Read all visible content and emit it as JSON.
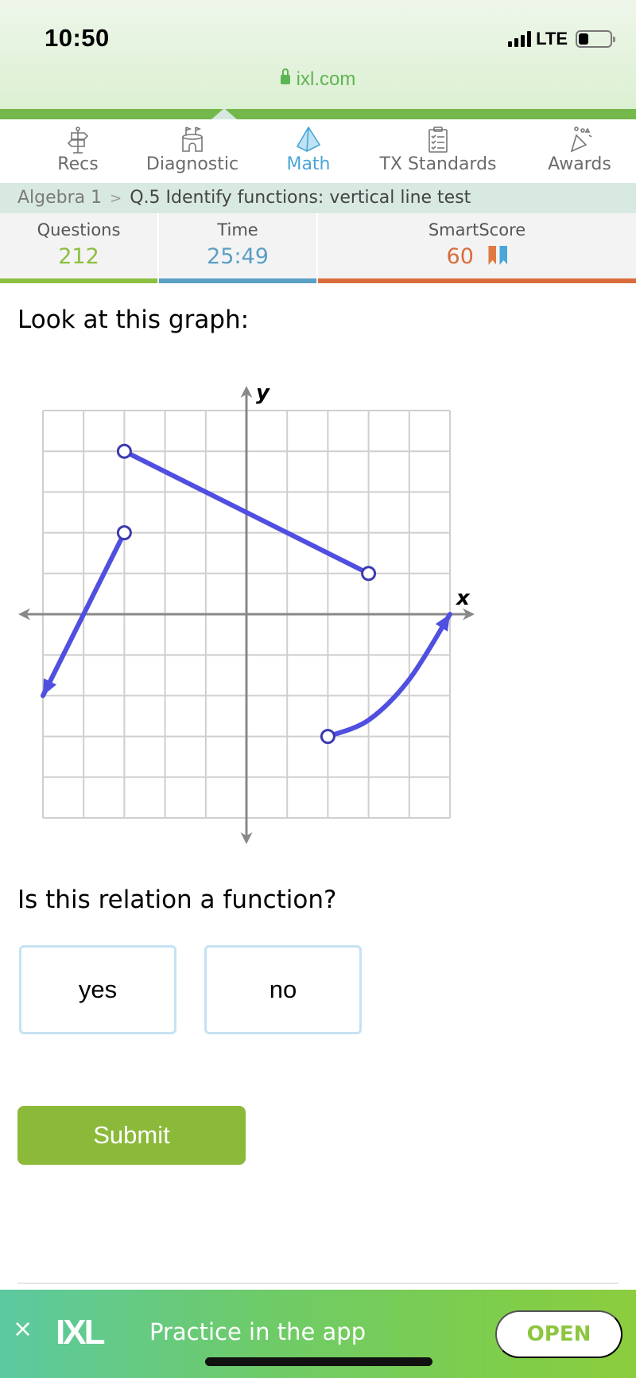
{
  "status_bar": {
    "time": "10:50",
    "network": "LTE",
    "url": "ixl.com"
  },
  "nav": {
    "items": [
      {
        "label": "Recs",
        "icon": "signpost-icon",
        "active": false
      },
      {
        "label": "Diagnostic",
        "icon": "castle-icon",
        "active": false
      },
      {
        "label": "Math",
        "icon": "pyramid-icon",
        "active": true
      },
      {
        "label": "TX Standards",
        "icon": "clipboard-icon",
        "active": false
      },
      {
        "label": "Awards",
        "icon": "party-popper-icon",
        "active": false
      }
    ]
  },
  "breadcrumb": {
    "parent": "Algebra 1",
    "separator": ">",
    "current": "Q.5 Identify functions: vertical line test"
  },
  "stats": {
    "questions_label": "Questions",
    "questions_value": "212",
    "time_label": "Time",
    "time_value": "25:49",
    "smartscore_label": "SmartScore",
    "smartscore_value": "60"
  },
  "colors": {
    "questions": "#8cbf3f",
    "time": "#5a9fc4",
    "smartscore": "#d96c3c",
    "accent_blue": "#4aa6d6",
    "graph_line": "#4f4fe0",
    "submit": "#8bb93a"
  },
  "problem": {
    "prompt": "Look at this graph:",
    "question": "Is this relation a function?",
    "choices": [
      "yes",
      "no"
    ],
    "submit_label": "Submit"
  },
  "chart_data": {
    "type": "line",
    "title": "",
    "xlabel": "x",
    "ylabel": "y",
    "xlim": [
      -5,
      5
    ],
    "ylim": [
      -5,
      5
    ],
    "grid": true,
    "series": [
      {
        "name": "segment-a",
        "kind": "segment",
        "points": [
          [
            -3,
            4
          ],
          [
            3,
            1
          ]
        ],
        "start": "open",
        "end": "open"
      },
      {
        "name": "ray-b",
        "kind": "ray",
        "points": [
          [
            -3,
            2
          ],
          [
            -4,
            0
          ],
          [
            -5,
            -2
          ]
        ],
        "start": "open",
        "end": "arrow"
      },
      {
        "name": "curve-c",
        "kind": "curve",
        "points": [
          [
            2,
            -3
          ],
          [
            3,
            -2.6
          ],
          [
            4,
            -1.6
          ],
          [
            5,
            0
          ]
        ],
        "start": "open",
        "end": "arrow"
      }
    ]
  },
  "banner": {
    "close": "×",
    "logo": "IXL",
    "text": "Practice in the app",
    "open_label": "OPEN"
  }
}
